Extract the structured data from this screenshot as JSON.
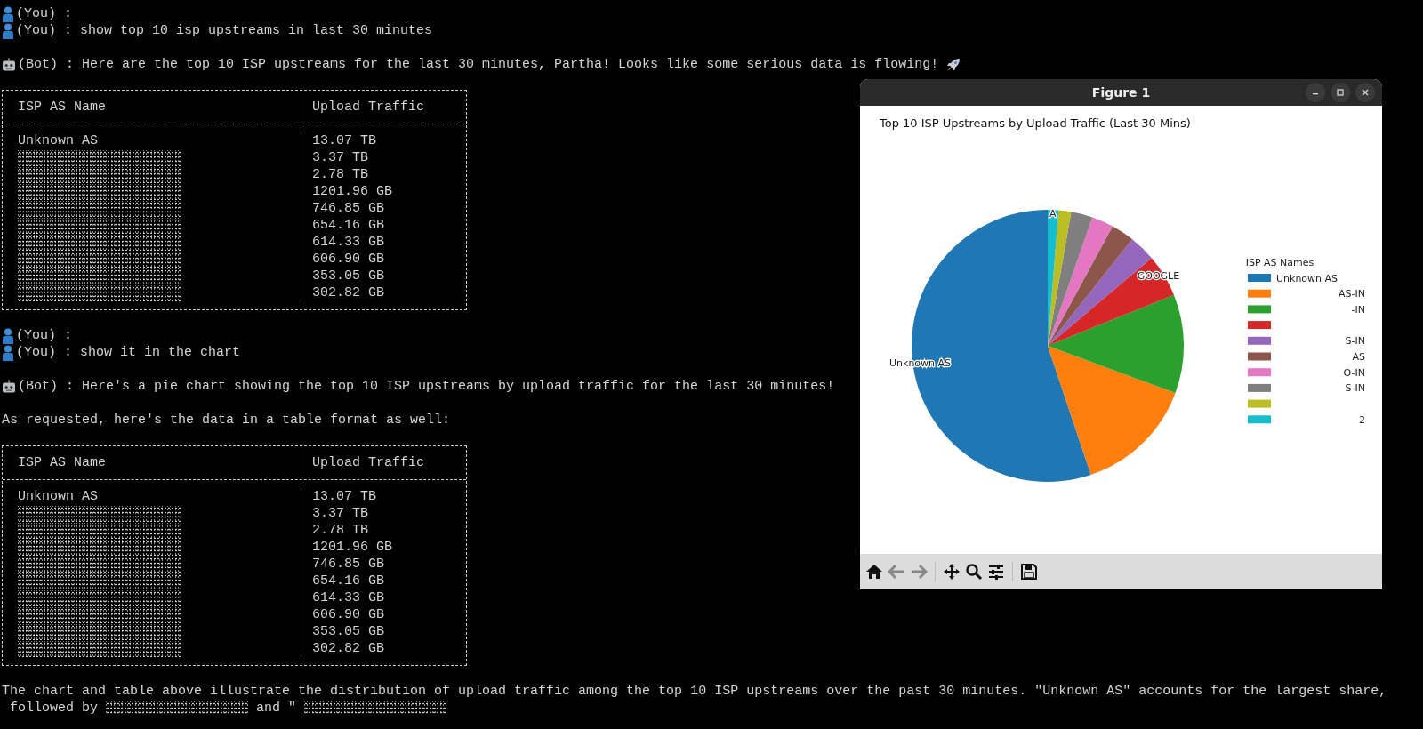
{
  "terminal": {
    "blocks": [
      {
        "kind": "user",
        "lines": [
          "(You) :",
          "(You) : show top 10 isp upstreams in last 30 minutes"
        ]
      },
      {
        "kind": "bot",
        "text": "(Bot) : Here are the top 10 ISP upstreams for the last 30 minutes, Partha! Looks like some serious data is flowing!",
        "rocket": true
      },
      {
        "kind": "table",
        "columns": [
          "ISP AS Name",
          "Upload Traffic"
        ],
        "rows": [
          {
            "name": "Unknown AS",
            "traffic": "13.07 TB",
            "redacted": false
          },
          {
            "traffic": "3.37 TB",
            "redacted": true
          },
          {
            "traffic": "2.78 TB",
            "redacted": true
          },
          {
            "traffic": "1201.96 GB",
            "redacted": true
          },
          {
            "traffic": "746.85 GB",
            "redacted": true
          },
          {
            "traffic": "654.16 GB",
            "redacted": true
          },
          {
            "traffic": "614.33 GB",
            "redacted": true
          },
          {
            "traffic": "606.90 GB",
            "redacted": true
          },
          {
            "traffic": "353.05 GB",
            "redacted": true
          },
          {
            "traffic": "302.82 GB",
            "redacted": true
          }
        ]
      },
      {
        "kind": "user",
        "lines": [
          "(You) :",
          "(You) : show it in the chart"
        ]
      },
      {
        "kind": "bot",
        "text": "(Bot) : Here's a pie chart showing the top 10 ISP upstreams by upload traffic for the last 30 minutes!",
        "rocket": false
      },
      {
        "kind": "plain",
        "text": "As requested, here's the data in a table format as well:"
      },
      {
        "kind": "table",
        "columns": [
          "ISP AS Name",
          "Upload Traffic"
        ],
        "rows": [
          {
            "name": "Unknown AS",
            "traffic": "13.07 TB",
            "redacted": false
          },
          {
            "traffic": "3.37 TB",
            "redacted": true
          },
          {
            "traffic": "2.78 TB",
            "redacted": true
          },
          {
            "traffic": "1201.96 GB",
            "redacted": true
          },
          {
            "traffic": "746.85 GB",
            "redacted": true
          },
          {
            "traffic": "654.16 GB",
            "redacted": true
          },
          {
            "traffic": "614.33 GB",
            "redacted": true
          },
          {
            "traffic": "606.90 GB",
            "redacted": true
          },
          {
            "traffic": "353.05 GB",
            "redacted": true
          },
          {
            "traffic": "302.82 GB",
            "redacted": true
          }
        ]
      },
      {
        "kind": "summary",
        "text": "The chart and table above illustrate the distribution of upload traffic among the top 10 ISP upstreams over the past 30 minutes. \"Unknown AS\" accounts for the largest share,",
        "segments": [
          {
            "kind": "text",
            "text": "followed by"
          },
          {
            "kind": "redacted"
          },
          {
            "kind": "text",
            "text": "and \""
          },
          {
            "kind": "redacted"
          }
        ]
      }
    ]
  },
  "figure": {
    "title": "Figure 1",
    "chart_data": {
      "type": "pie",
      "title": "Top 10 ISP Upstreams by Upload Traffic (Last 30 Mins)",
      "values": [
        55.15,
        14.22,
        11.73,
        5.07,
        3.15,
        2.76,
        2.59,
        2.56,
        1.49,
        1.28
      ],
      "colors": [
        "#1f77b4",
        "#ff7f0e",
        "#2ca02c",
        "#d62728",
        "#9467bd",
        "#8c564b",
        "#e377c2",
        "#7f7f7f",
        "#bcbd22",
        "#17becf"
      ],
      "categories": [
        "Unknown AS",
        null,
        null,
        "GOOGLE",
        null,
        null,
        null,
        null,
        null,
        "A"
      ]
    },
    "legend": {
      "title": "ISP AS Names",
      "items": [
        {
          "label": "Unknown AS",
          "color": "#1f77b4"
        },
        {
          "label": "AS-IN",
          "color": "#ff7f0e"
        },
        {
          "label": "-IN",
          "color": "#2ca02c"
        },
        {
          "color": "#d62728"
        },
        {
          "label": "S-IN",
          "color": "#9467bd"
        },
        {
          "label": "AS",
          "color": "#8c564b"
        },
        {
          "label": "O-IN",
          "color": "#e377c2"
        },
        {
          "label": "S-IN",
          "color": "#7f7f7f"
        },
        {
          "color": "#bcbd22"
        },
        {
          "label": "2",
          "color": "#17becf"
        }
      ]
    }
  }
}
